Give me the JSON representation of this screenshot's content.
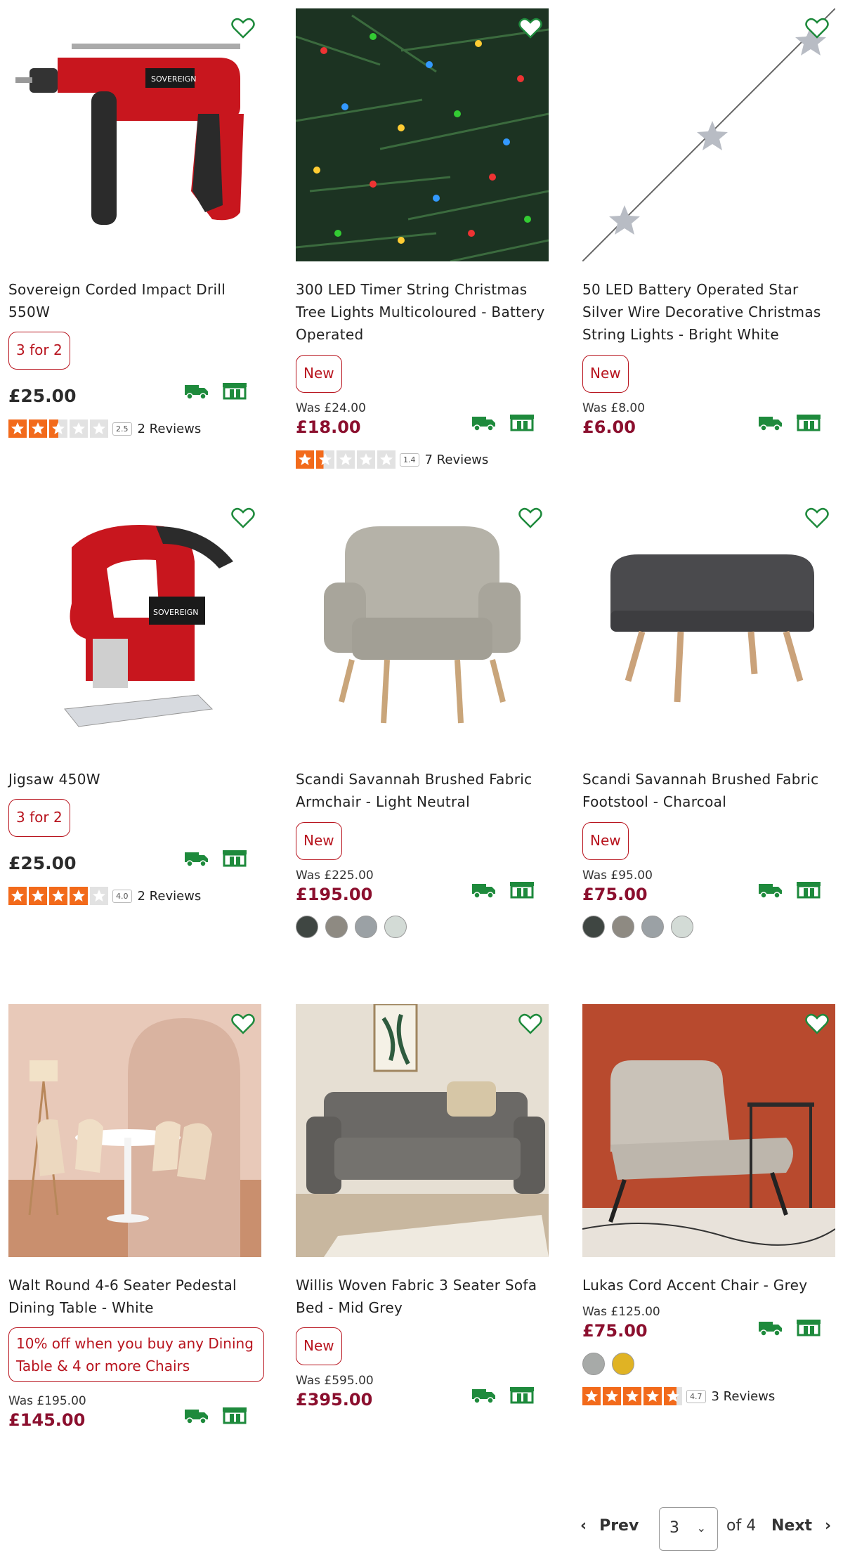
{
  "products": [
    {
      "name": "Sovereign Corded Impact Drill 550W",
      "badge": "3 for 2",
      "was": "",
      "price": "£25.00",
      "rating": 2.5,
      "rating_text": "2.5",
      "reviews": "2 Reviews",
      "swatches": []
    },
    {
      "name": "300 LED Timer String Christmas Tree Lights Multicoloured - Battery Operated",
      "badge": "New",
      "was": "Was £24.00",
      "price": "£18.00",
      "rating": 1.4,
      "rating_text": "1.4",
      "reviews": "7 Reviews",
      "swatches": []
    },
    {
      "name": "50 LED Battery Operated Star Silver Wire Decorative Christmas String Lights - Bright White",
      "badge": "New",
      "was": "Was £8.00",
      "price": "£6.00",
      "swatches": []
    },
    {
      "name": "Jigsaw 450W",
      "badge": "3 for 2",
      "was": "",
      "price": "£25.00",
      "rating": 4.0,
      "rating_text": "4.0",
      "reviews": "2 Reviews",
      "swatches": []
    },
    {
      "name": "Scandi Savannah Brushed Fabric Armchair - Light Neutral",
      "badge": "New",
      "was": "Was £225.00",
      "price": "£195.00",
      "swatches": [
        "#3f4642",
        "#8e8a82",
        "#9ba1a5",
        "#d3dbd6"
      ]
    },
    {
      "name": "Scandi Savannah Brushed Fabric Footstool - Charcoal",
      "badge": "New",
      "was": "Was £95.00",
      "price": "£75.00",
      "swatches": [
        "#3f4642",
        "#8e8a82",
        "#9ba1a5",
        "#d3dbd6"
      ]
    },
    {
      "name": "Walt Round 4-6 Seater Pedestal Dining Table - White",
      "badge": "10% off when you buy any Dining Table & 4 or more Chairs",
      "was": "Was £195.00",
      "price": "£145.00",
      "swatches": []
    },
    {
      "name": "Willis Woven Fabric 3 Seater Sofa Bed - Mid Grey",
      "badge": "New",
      "was": "Was £595.00",
      "price": "£395.00",
      "swatches": []
    },
    {
      "name": "Lukas Cord Accent Chair - Grey",
      "badge": "",
      "was": "Was £125.00",
      "price": "£75.00",
      "rating": 4.7,
      "rating_text": "4.7",
      "reviews": "3 Reviews",
      "swatches": [
        "#a7aaa8",
        "#e0b324"
      ]
    }
  ],
  "pagination": {
    "prev": "Prev",
    "current": "3",
    "of": "of 4",
    "next": "Next"
  },
  "colors": {
    "accent_green": "#1e8a3c",
    "price_red": "#8b0f2e",
    "badge_red": "#b8141e",
    "star_orange": "#f26a1b"
  },
  "icons": [
    "heart-icon",
    "delivery-van-icon",
    "click-collect-icon",
    "star-icon",
    "chevron-left-icon",
    "chevron-right-icon",
    "chevron-down-icon"
  ]
}
